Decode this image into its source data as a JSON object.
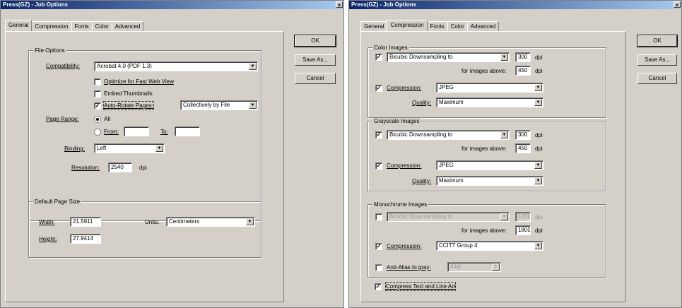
{
  "left": {
    "title": "Press(GZ) - Job Options",
    "close": "×",
    "tabs": [
      "General",
      "Compression",
      "Fonts",
      "Color",
      "Advanced"
    ],
    "file_options": {
      "title": "File Options",
      "compatibility_label": "Compatibility:",
      "compatibility_value": "Acrobat 4.0 (PDF 1.3)",
      "optimize_label": "Optimize for Fast Web View",
      "embed_thumbs_label": "Embed Thumbnails",
      "auto_rotate_label": "Auto-Rotate Pages:",
      "auto_rotate_value": "Collectively by File",
      "page_range_label": "Page Range:",
      "all_label": "All",
      "from_label": "From:",
      "to_label": "To:",
      "binding_label": "Binding:",
      "binding_value": "Left",
      "resolution_label": "Resolution:",
      "resolution_value": "2540",
      "resolution_unit": "dpi"
    },
    "page_size": {
      "title": "Default Page Size",
      "width_label": "Width:",
      "width_value": "21.5911",
      "height_label": "Height:",
      "height_value": "27.9414",
      "units_label": "Units:",
      "units_value": "Centimeters"
    },
    "buttons": {
      "ok": "OK",
      "save_as": "Save As...",
      "cancel": "Cancel"
    }
  },
  "right": {
    "title": "Press(GZ) - Job Options",
    "close": "×",
    "tabs": [
      "General",
      "Compression",
      "Fonts",
      "Color",
      "Advanced"
    ],
    "color": {
      "title": "Color Images",
      "downsample_value": "Bicubic Downsampling to",
      "dpi_value": "300",
      "dpi_unit": "dpi",
      "above_label": "for images above:",
      "above_value": "450",
      "compression_label": "Compression:",
      "compression_value": "JPEG",
      "quality_label": "Quality:",
      "quality_value": "Maximum"
    },
    "gray": {
      "title": "Grayscale Images",
      "downsample_value": "Bicubic Downsampling to",
      "dpi_value": "300",
      "dpi_unit": "dpi",
      "above_label": "for images above:",
      "above_value": "450",
      "compression_label": "Compression:",
      "compression_value": "JPEG",
      "quality_label": "Quality:",
      "quality_value": "Maximum"
    },
    "mono": {
      "title": "Monochrome Images",
      "downsample_value": "Bicubic Downsampling to",
      "dpi_value": "1200",
      "dpi_unit": "dpi",
      "above_label": "for images above:",
      "above_value": "1800",
      "compression_label": "Compression:",
      "compression_value": "CCITT Group 4",
      "antialias_label": "Anti-Alias to gray:",
      "antialias_value": "4 bit"
    },
    "compress_text_label": "Compress Text and Line Art",
    "buttons": {
      "ok": "OK",
      "save_as": "Save As...",
      "cancel": "Cancel"
    }
  }
}
